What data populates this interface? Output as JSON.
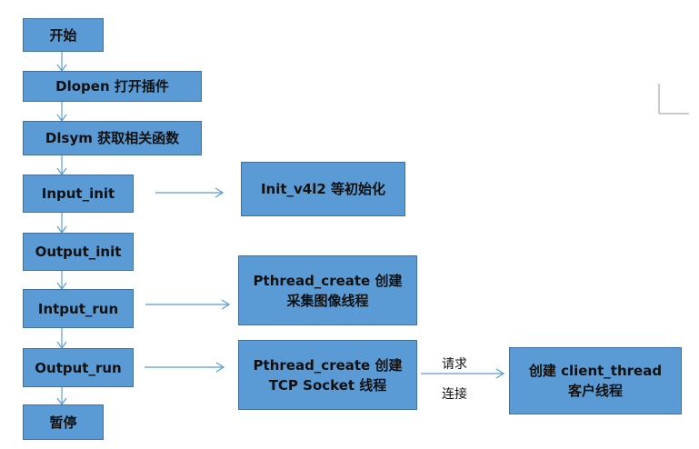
{
  "colors": {
    "box_fill": "#5b9bd5",
    "box_border": "#41719c",
    "arrow": "#5b9bd5",
    "corner_mark": "#9a9a9a"
  },
  "nodes": {
    "start": "开始",
    "dlopen": "Dlopen 打开插件",
    "dlsym": "Dlsym 获取相关函数",
    "input_init": "Input_init",
    "output_init": "Output_init",
    "intput_run": "Intput_run",
    "output_run": "Output_run",
    "stop": "暂停",
    "init_v4l2": "Init_v4l2 等初始化",
    "pthread_capture": {
      "line1": "Pthread_create 创建",
      "line2": "采集图像线程"
    },
    "pthread_tcp": {
      "line1": "Pthread_create 创建",
      "line2": "TCP Socket 线程"
    },
    "client_thread": {
      "line1": "创建 client_thread",
      "line2": "客户线程"
    }
  },
  "edge_labels": {
    "request_line1": "请求",
    "request_line2": "连接"
  }
}
